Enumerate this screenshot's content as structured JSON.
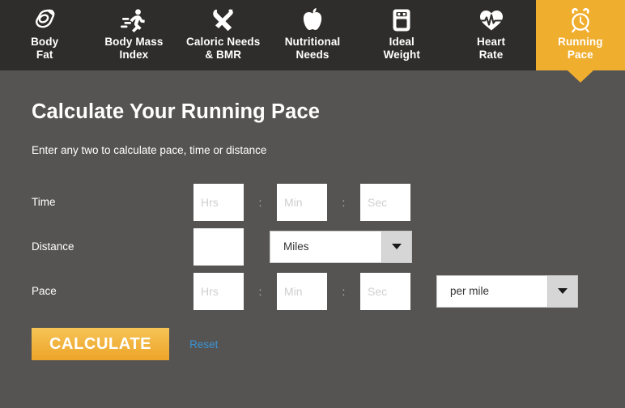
{
  "nav": {
    "tabs": [
      {
        "label": "Body\nFat",
        "icon": "caliper-icon",
        "active": false
      },
      {
        "label": "Body Mass\nIndex",
        "icon": "running-person-icon",
        "active": false
      },
      {
        "label": "Caloric Needs\n& BMR",
        "icon": "fork-knife-icon",
        "active": false
      },
      {
        "label": "Nutritional\nNeeds",
        "icon": "apple-icon",
        "active": false
      },
      {
        "label": "Ideal\nWeight",
        "icon": "weight-scale-icon",
        "active": false
      },
      {
        "label": "Heart\nRate",
        "icon": "heart-pulse-icon",
        "active": false
      },
      {
        "label": "Running\nPace",
        "icon": "alarm-clock-icon",
        "active": true
      }
    ]
  },
  "page": {
    "title": "Calculate Your Running Pace",
    "subtitle": "Enter any two to calculate pace, time or distance"
  },
  "form": {
    "time": {
      "label": "Time",
      "hours": {
        "value": "",
        "placeholder": "Hrs"
      },
      "minutes": {
        "value": "",
        "placeholder": "Min"
      },
      "seconds": {
        "value": "",
        "placeholder": "Sec"
      },
      "separator": ":"
    },
    "distance": {
      "label": "Distance",
      "amount": {
        "value": "",
        "placeholder": ""
      },
      "unit": {
        "selected": "Miles"
      }
    },
    "pace": {
      "label": "Pace",
      "hours": {
        "value": "",
        "placeholder": "Hrs"
      },
      "minutes": {
        "value": "",
        "placeholder": "Min"
      },
      "seconds": {
        "value": "",
        "placeholder": "Sec"
      },
      "separator": ":",
      "unit": {
        "selected": "per mile"
      }
    }
  },
  "actions": {
    "calculate_label": "CALCULATE",
    "reset_label": "Reset"
  },
  "colors": {
    "accent": "#f0ae2e",
    "nav_background": "#2e2d2c",
    "page_background": "#555453",
    "link": "#3b93d4"
  }
}
